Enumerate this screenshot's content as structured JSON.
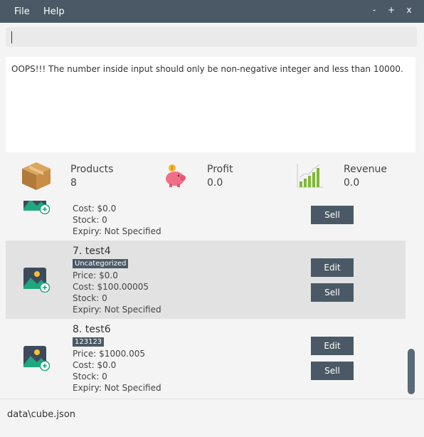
{
  "menu": {
    "file": "File",
    "help": "Help"
  },
  "window_controls": {
    "minimize": "-",
    "maximize": "+",
    "close": "x"
  },
  "command": {
    "value": ""
  },
  "result": {
    "message": "OOPS!!! The number inside input should only be non-negative integer and less than 10000."
  },
  "stats": {
    "products": {
      "title": "Products",
      "value": "8"
    },
    "profit": {
      "title": "Profit",
      "value": "0.0"
    },
    "revenue": {
      "title": "Revenue",
      "value": "0.0"
    }
  },
  "products": [
    {
      "cost": "Cost: $0.0",
      "stock": "Stock: 0",
      "expiry": "Expiry: Not Specified",
      "sell_label": "Sell"
    },
    {
      "title": "7.  test4",
      "tag": "Uncategorized",
      "price": "Price: $0.0",
      "cost": "Cost: $100.00005",
      "stock": "Stock: 0",
      "expiry": "Expiry: Not Specified",
      "edit_label": "Edit",
      "sell_label": "Sell"
    },
    {
      "title": "8.  test6",
      "tag": "123123",
      "price": "Price: $1000.005",
      "cost": "Cost: $0.0",
      "stock": "Stock: 0",
      "expiry": "Expiry: Not Specified",
      "edit_label": "Edit",
      "sell_label": "Sell"
    }
  ],
  "status": {
    "file_path": "data\\cube.json"
  },
  "colors": {
    "primary": "#4a5965",
    "accent_green": "#1fa77f",
    "icon_dark": "#3d4a5c"
  },
  "icons": {
    "products": "cardboard-box-icon",
    "profit": "piggy-bank-icon",
    "revenue": "bar-chart-icon",
    "thumbnail": "add-image-icon"
  }
}
